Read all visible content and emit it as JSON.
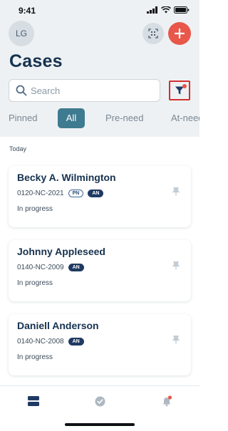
{
  "status_bar": {
    "time": "9:41"
  },
  "header": {
    "avatar_initials": "LG",
    "title": "Cases"
  },
  "search": {
    "placeholder": "Search"
  },
  "tabs": [
    {
      "label": "Pinned",
      "active": false
    },
    {
      "label": "All",
      "active": true
    },
    {
      "label": "Pre-need",
      "active": false
    },
    {
      "label": "At-need",
      "active": false
    }
  ],
  "section": {
    "label": "Today"
  },
  "cases": [
    {
      "name": "Becky A. Wilmington",
      "case_number": "0120-NC-2021",
      "badges": [
        "PN",
        "AN"
      ],
      "status": "In progress"
    },
    {
      "name": "Johnny Appleseed",
      "case_number": "0140-NC-2009",
      "badges": [
        "AN"
      ],
      "status": "In progress"
    },
    {
      "name": "Daniell Anderson",
      "case_number": "0140-NC-2008",
      "badges": [
        "AN"
      ],
      "status": "In progress"
    }
  ],
  "colors": {
    "accent": "#3e7b90",
    "primary_text": "#16324f",
    "add_button": "#e8574a",
    "highlight_border": "#d32f2f"
  },
  "icons": {
    "qr": "qr-scan-icon",
    "add": "plus-icon",
    "search": "search-icon",
    "filter": "filter-icon",
    "pin": "pin-icon",
    "nav": [
      "cases-icon",
      "check-circle-icon",
      "bell-icon"
    ]
  }
}
